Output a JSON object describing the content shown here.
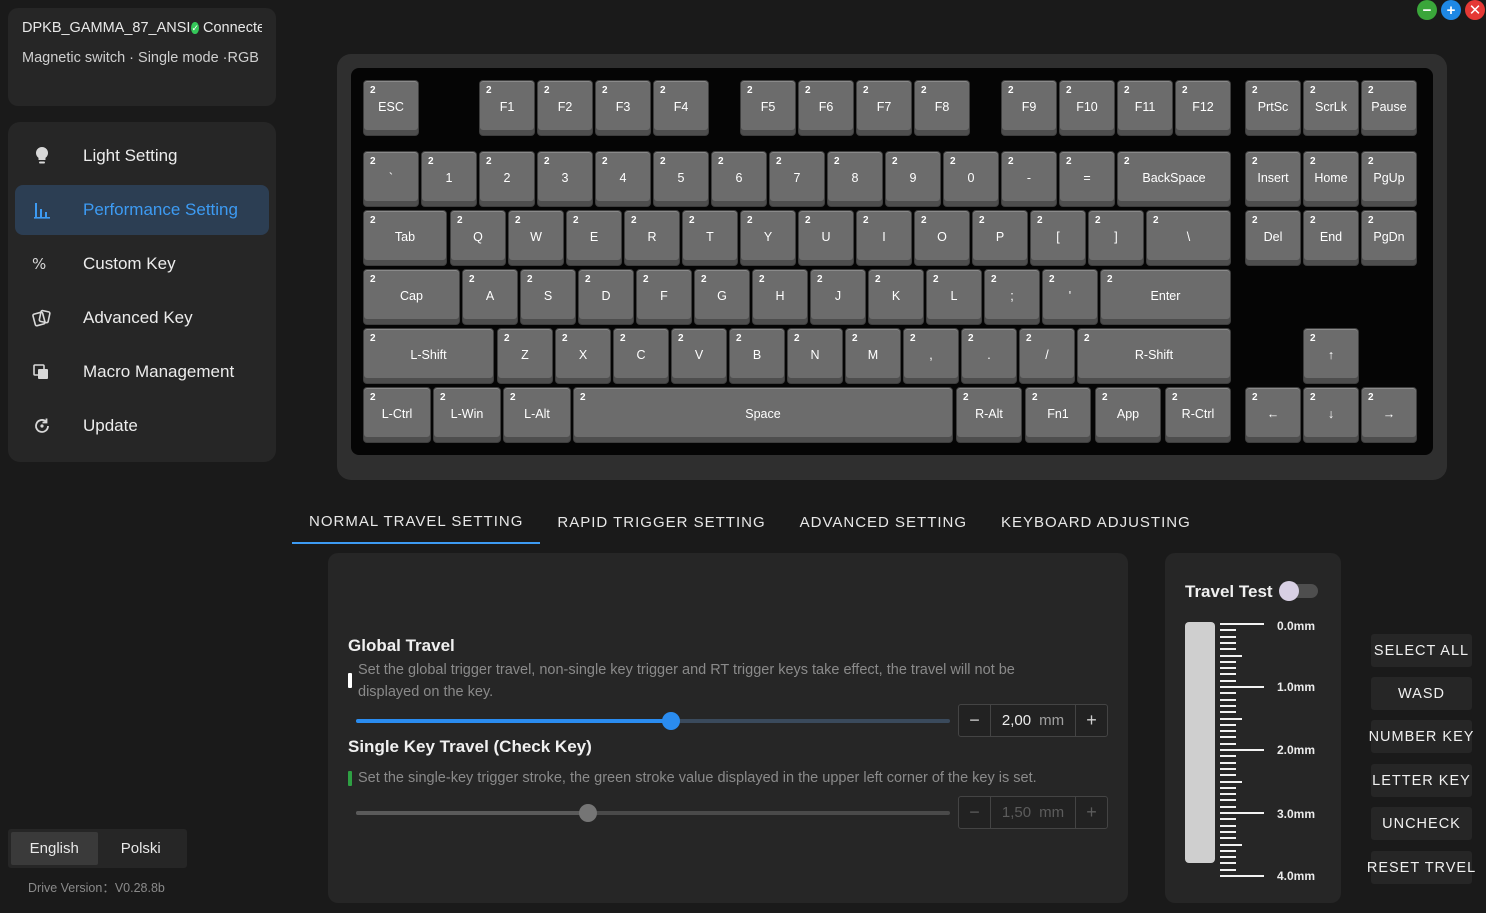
{
  "window": {
    "minimize_icon": "minus-icon",
    "maximize_icon": "plus-icon",
    "close_icon": "close-icon"
  },
  "device": {
    "name": "DPKB_GAMMA_87_ANSI",
    "status": "Connecte",
    "status_icon": "check-circle-icon",
    "status_color": "#34c759",
    "description": "Magnetic switch · Single mode ·RGB"
  },
  "sidebar": {
    "items": [
      {
        "label": "Light Setting",
        "icon": "bulb-icon",
        "active": false
      },
      {
        "label": "Performance Setting",
        "icon": "bar-chart-icon",
        "active": true
      },
      {
        "label": "Custom Key",
        "icon": "percent-icon",
        "active": false
      },
      {
        "label": "Advanced Key",
        "icon": "cards-icon",
        "active": false
      },
      {
        "label": "Macro Management",
        "icon": "layers-icon",
        "active": false
      },
      {
        "label": "Update",
        "icon": "refresh-icon",
        "active": false
      }
    ],
    "accent": "#3d9bf3"
  },
  "language": {
    "options": [
      "English",
      "Polski"
    ],
    "selected": "English"
  },
  "drive_version": "Drive Version：V0.28.8b",
  "keyboard": {
    "default_travel": "2",
    "rows": [
      [
        "ESC",
        "F1",
        "F2",
        "F3",
        "F4",
        "F5",
        "F6",
        "F7",
        "F8",
        "F9",
        "F10",
        "F11",
        "F12",
        "PrtSc",
        "ScrLk",
        "Pause"
      ],
      [
        "`",
        "1",
        "2",
        "3",
        "4",
        "5",
        "6",
        "7",
        "8",
        "9",
        "0",
        "-",
        "=",
        "BackSpace",
        "Insert",
        "Home",
        "PgUp"
      ],
      [
        "Tab",
        "Q",
        "W",
        "E",
        "R",
        "T",
        "Y",
        "U",
        "I",
        "O",
        "P",
        "[",
        "]",
        "\\",
        "Del",
        "End",
        "PgDn"
      ],
      [
        "Cap",
        "A",
        "S",
        "D",
        "F",
        "G",
        "H",
        "J",
        "K",
        "L",
        ";",
        "'",
        "Enter"
      ],
      [
        "L-Shift",
        "Z",
        "X",
        "C",
        "V",
        "B",
        "N",
        "M",
        ",",
        ".",
        "/",
        "R-Shift",
        "↑"
      ],
      [
        "L-Ctrl",
        "L-Win",
        "L-Alt",
        "Space",
        "R-Alt",
        "Fn1",
        "App",
        "R-Ctrl",
        "←",
        "↓",
        "→"
      ]
    ]
  },
  "tabs": [
    "NORMAL TRAVEL SETTING",
    "RAPID TRIGGER SETTING",
    "ADVANCED SETTING",
    "KEYBOARD ADJUSTING"
  ],
  "active_tab": "NORMAL TRAVEL SETTING",
  "global_travel": {
    "title": "Global Travel",
    "description": "Set the global trigger travel, non-single key trigger and RT trigger keys take effect, the travel will not be displayed on the key.",
    "value": "2,00",
    "unit": "mm",
    "slider_fraction": 0.53
  },
  "single_key_travel": {
    "title": "Single Key Travel  (Check Key)",
    "description": "Set the single-key trigger stroke, the green stroke value displayed in the upper left corner of the key is set.",
    "value": "1,50",
    "unit": "mm",
    "slider_fraction": 0.39,
    "marker_color": "#2ea043",
    "enabled": false
  },
  "travel_test": {
    "title": "Travel Test",
    "enabled": false,
    "scale_labels": [
      "0.0mm",
      "1.0mm",
      "2.0mm",
      "3.0mm",
      "4.0mm"
    ]
  },
  "actions": [
    "SELECT ALL",
    "WASD",
    "NUMBER KEY",
    "LETTER KEY",
    "UNCHECK",
    "RESET TRVEL"
  ]
}
